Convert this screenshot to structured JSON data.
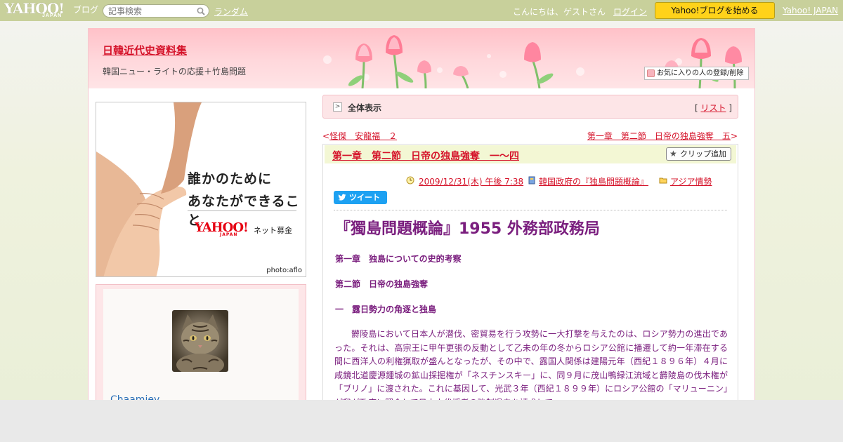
{
  "topbar": {
    "logo_text": "YAHOO!",
    "logo_sub": "JAPAN",
    "logo_blog": "ブログ",
    "search_placeholder": "記事検索",
    "random_link": "ランダム",
    "greeting": "こんにちは、ゲストさん",
    "login_link": "ログイン",
    "start_button": "Yahoo!ブログを始める",
    "yahoo_japan_link": "Yahoo! JAPAN"
  },
  "header": {
    "blog_title": "日韓近代史資料集",
    "subtitle": "韓国ニュー・ライトの応援＋竹島問題",
    "favorite_button": "お気に入りの人の登録/削除"
  },
  "sidebar": {
    "ad": {
      "line1": "誰かのために",
      "line2": "あなたができること",
      "logo": "YAHOO!",
      "logo_sub": "JAPAN",
      "service": "ネット募金",
      "credit": "photo:aflo"
    },
    "profile": {
      "username": "Chaamiey"
    }
  },
  "main": {
    "crumb_label": "全体表示",
    "list_open": "[",
    "list_link": "リスト",
    "list_close": "]",
    "prev_arrow": "<",
    "prev_link": "怪傑　安龍福　２",
    "next_link": "第一章　第二節　日帝の独島強奪　五",
    "next_arrow": ">",
    "article": {
      "title": "第一章　第二節　日帝の独島強奪　一～四",
      "clip_button": "クリップ追加",
      "date": "2009/12/31(木) 午後 7:38",
      "category": "韓国政府の『独島問題概論』",
      "folder": "アジア情勢",
      "tweet_button": "ツイート",
      "heading": "『獨島問題概論』1955 外務部政務局",
      "chapter": "第一章　独島についての史的考察",
      "section": "第二節　日帝の独島強奪",
      "subsection": "一　露日勢力の角逐と独島",
      "body": "欝陵島において日本人が潜伐、密貿易を行う攻勢に一大打撃を与えたのは、ロシア勢力の進出であった。それは、高宗王に甲午更張の反動として乙未の年の冬からロシア公館に播遷して約一年滞在する間に西洋人の利権猟取が盛んとなったが、その中で、露国人関係は建陽元年（西紀１８９６年）４月に咸鏡北道慶源鍾城の鉱山採掘権が「ネスチンスキー」に、同９月に茂山鴨緑江流域と欝陵島の伐木権が「ブリノ」に渡された。これに基因して、光武３年（西紀１８９９年）にロシア公館の「マリューニン」が我が政府に照会して日本人伐採者の強制退去を請求して"
    }
  },
  "colors": {
    "topbar": "#c8d09b",
    "link_red": "#d5132a",
    "article_purple": "#7a1e7e",
    "header_pink": "#ffc1c8",
    "start_yellow": "#ffd21a",
    "tweet_blue": "#1da1f2"
  },
  "icons": {
    "search": "magnifier-icon",
    "clip": "star-icon",
    "date": "clock-icon",
    "category": "book-icon",
    "folder": "folder-icon",
    "tweet": "twitter-bird-icon"
  }
}
